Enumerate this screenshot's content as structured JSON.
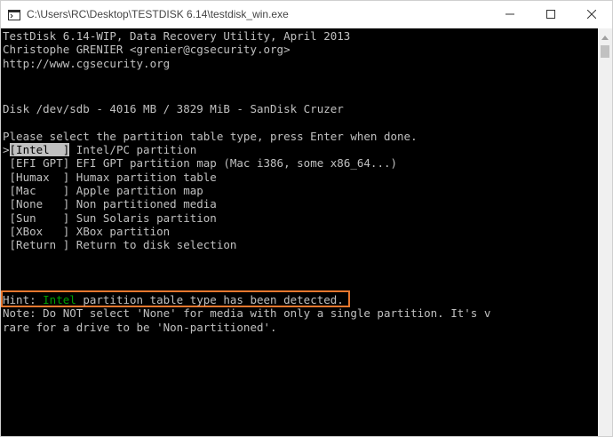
{
  "window": {
    "title": "C:\\Users\\RC\\Desktop\\TESTDISK 6.14\\testdisk_win.exe"
  },
  "console": {
    "header": [
      "TestDisk 6.14-WIP, Data Recovery Utility, April 2013",
      "Christophe GRENIER <grenier@cgsecurity.org>",
      "http://www.cgsecurity.org"
    ],
    "disk_line": "Disk /dev/sdb - 4016 MB / 3829 MiB - SanDisk Cruzer",
    "prompt": "Please select the partition table type, press Enter when done.",
    "options": [
      {
        "cursor": ">",
        "key": "[Intel  ]",
        "desc": " Intel/PC partition"
      },
      {
        "cursor": " ",
        "key": "[EFI GPT]",
        "desc": " EFI GPT partition map (Mac i386, some x86_64...)"
      },
      {
        "cursor": " ",
        "key": "[Humax  ]",
        "desc": " Humax partition table"
      },
      {
        "cursor": " ",
        "key": "[Mac    ]",
        "desc": " Apple partition map"
      },
      {
        "cursor": " ",
        "key": "[None   ]",
        "desc": " Non partitioned media"
      },
      {
        "cursor": " ",
        "key": "[Sun    ]",
        "desc": " Sun Solaris partition"
      },
      {
        "cursor": " ",
        "key": "[XBox   ]",
        "desc": " XBox partition"
      },
      {
        "cursor": " ",
        "key": "[Return ]",
        "desc": " Return to disk selection"
      }
    ],
    "hint": {
      "prefix": "Hint: ",
      "highlight": "Intel",
      "suffix": " partition table type has been detected."
    },
    "note": [
      "Note: Do NOT select 'None' for media with only a single partition. It's v",
      "rare for a drive to be 'Non-partitioned'."
    ]
  },
  "colors": {
    "console_bg": "#000000",
    "console_fg": "#c0c0c0",
    "highlight_green": "#00a000",
    "hint_border": "#e8772e"
  }
}
